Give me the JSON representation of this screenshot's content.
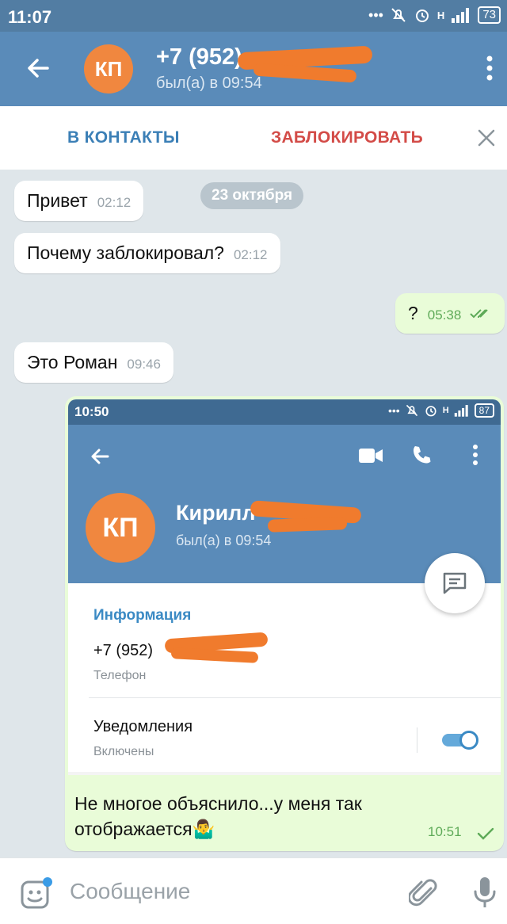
{
  "status_bar": {
    "time": "11:07",
    "network": "H",
    "battery": "73"
  },
  "header": {
    "avatar_initials": "КП",
    "title": "+7 (952)",
    "subtitle": "был(а) в 09:54",
    "icons": {
      "back": "arrow-left-icon",
      "menu": "more-vertical-icon"
    }
  },
  "action_bar": {
    "add_contact": "В КОНТАКТЫ",
    "block": "ЗАБЛОКИРОВАТЬ",
    "colors": {
      "add": "#3b7fb6",
      "block": "#d34b47"
    }
  },
  "chat": {
    "date_chip": "23 октября",
    "messages": [
      {
        "text": "Привет",
        "time": "02:12",
        "direction": "in"
      },
      {
        "text": "Почему заблокировал?",
        "time": "02:12",
        "direction": "in"
      },
      {
        "text": "?",
        "time": "05:38",
        "direction": "out",
        "status": "read"
      },
      {
        "text": "Это Роман",
        "time": "09:46",
        "direction": "in"
      }
    ],
    "screenshot_message": {
      "caption_line1": "Не многое объяснило...у меня так",
      "caption_line2": "отображается🤷‍♂️",
      "time": "10:51",
      "status": "sent",
      "screenshot": {
        "status_time": "10:50",
        "network": "H",
        "battery": "87",
        "avatar_initials": "КП",
        "name": "Кирилл",
        "last_seen": "был(а) в 09:54",
        "info_header": "Информация",
        "phone": "+7 (952)",
        "phone_label": "Телефон",
        "notifications_label": "Уведомления",
        "notifications_state": "Включены",
        "notifications_enabled": true
      }
    }
  },
  "input_bar": {
    "placeholder": "Сообщение",
    "icons": {
      "emoji": "sticker-icon",
      "attach": "paperclip-icon",
      "mic": "microphone-icon"
    }
  },
  "colors": {
    "header": "#5a8bb9",
    "status_bar": "#527da3",
    "avatar": "#f0873f",
    "outgoing_bubble": "#e9fcd8",
    "chat_background": "#dfe6ea",
    "redaction": "#f07b2d"
  }
}
